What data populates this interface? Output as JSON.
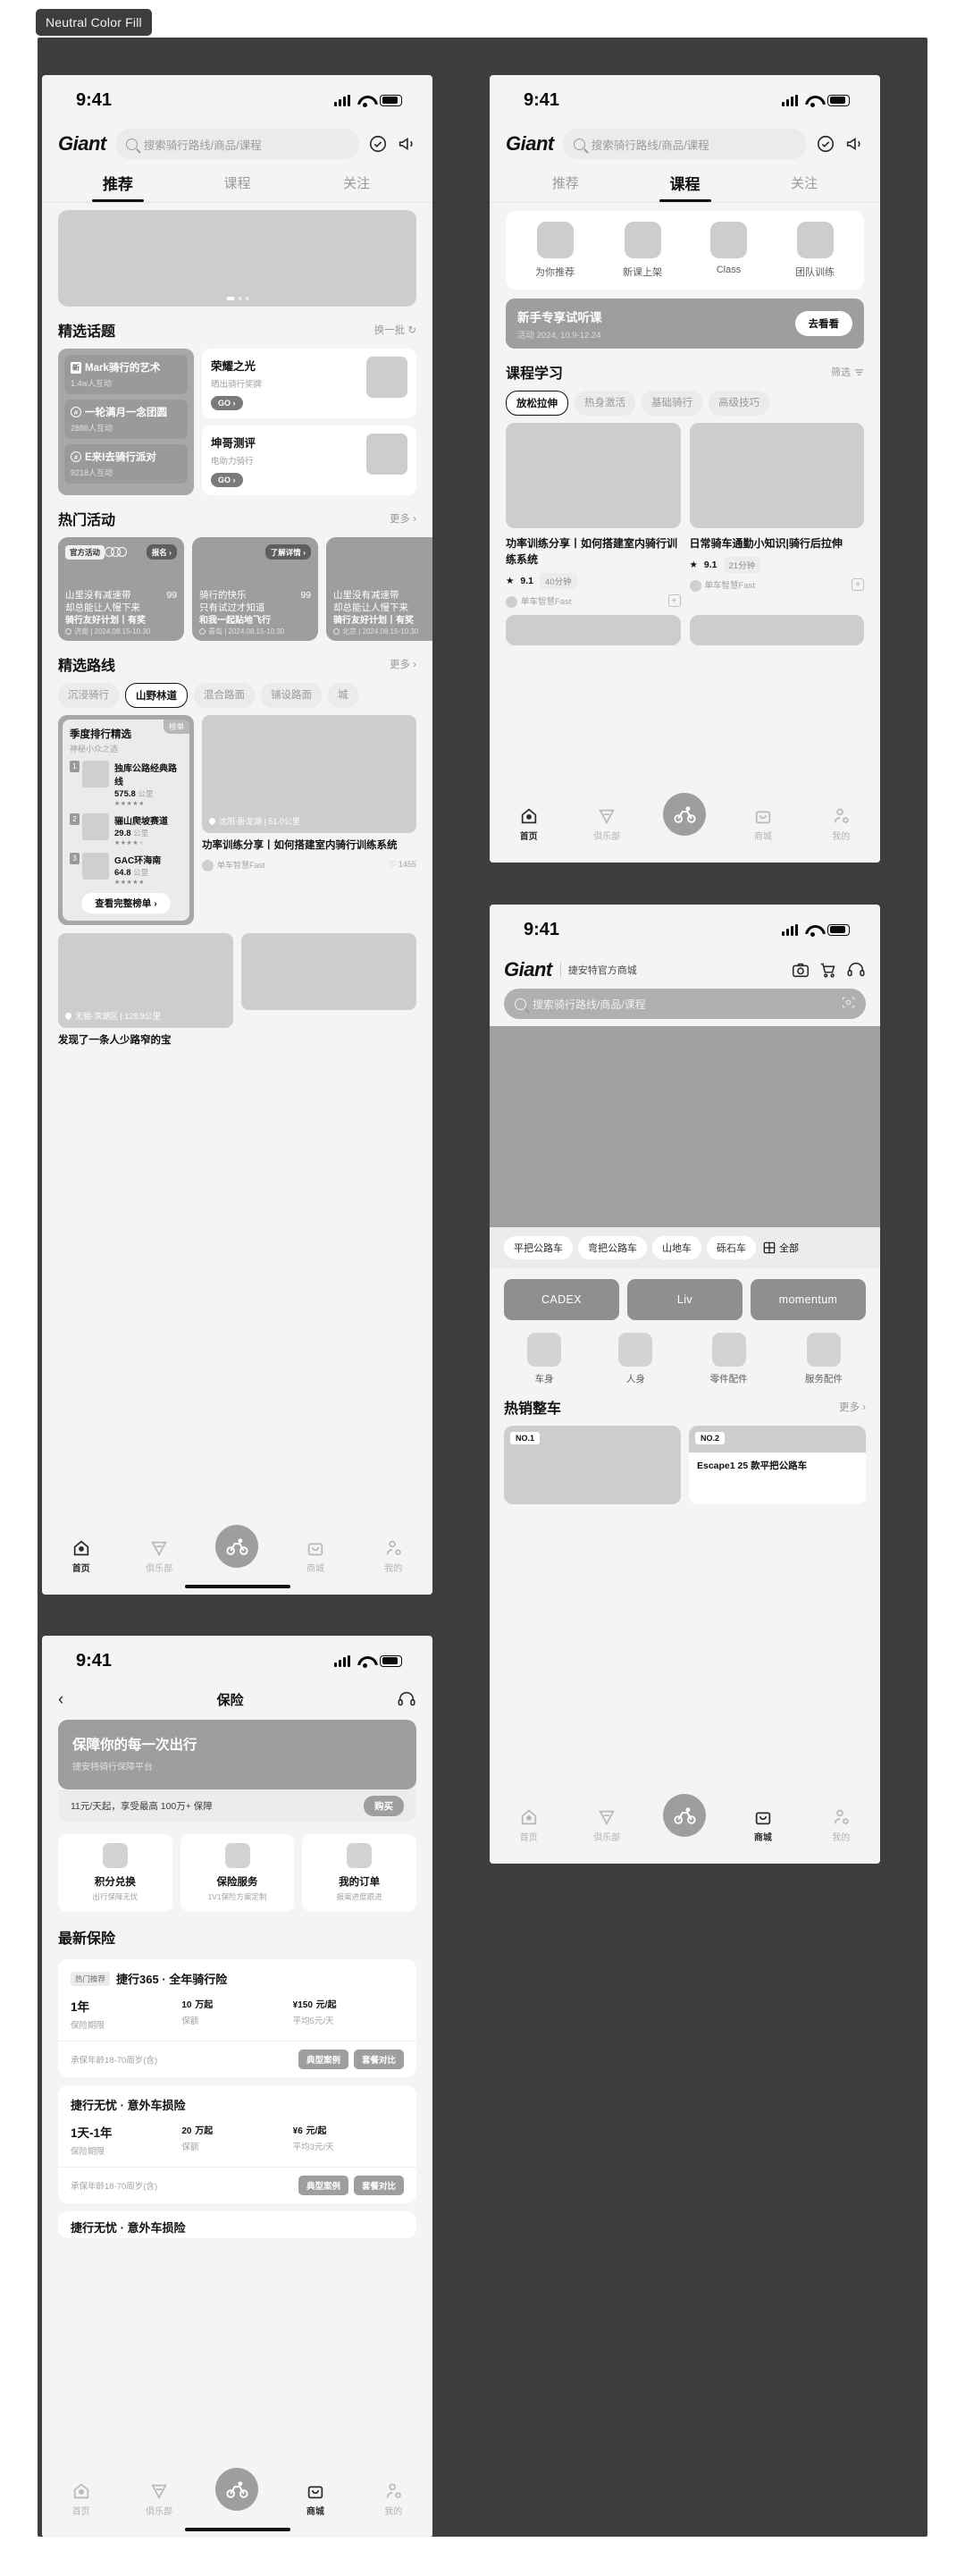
{
  "page": {
    "tag_label": "Neutral Color Fill"
  },
  "status": {
    "time": "9:41"
  },
  "app": {
    "brand": "Giant",
    "search_placeholder": "搜索骑行路线/商品/课程",
    "icons": {
      "check": "check-circle-icon",
      "bell": "megaphone-icon"
    }
  },
  "tabbar": {
    "items": [
      {
        "label": "首页",
        "icon": "home-icon"
      },
      {
        "label": "俱乐部",
        "icon": "club-icon"
      },
      {
        "label": "",
        "icon": "bike-icon"
      },
      {
        "label": "商城",
        "icon": "shop-icon"
      },
      {
        "label": "我的",
        "icon": "profile-icon"
      }
    ]
  },
  "phone1": {
    "tabs": [
      {
        "label": "推荐",
        "active": true
      },
      {
        "label": "课程",
        "active": false
      },
      {
        "label": "关注",
        "active": false
      }
    ],
    "topics": {
      "title": "精选话题",
      "more": "换一批 ↻",
      "list": [
        {
          "badge": "新",
          "title": "Mark骑行的艺术",
          "sub": "1.4w人互动"
        },
        {
          "badge": "#",
          "title": "一轮满月一念团圆",
          "sub": "2888人互动"
        },
        {
          "badge": "#",
          "title": "E来I去骑行派对",
          "sub": "9218人互动"
        }
      ],
      "cards": [
        {
          "title": "荣耀之光",
          "sub": "晒出骑行奖牌",
          "cta": "GO ›"
        },
        {
          "title": "坤哥测评",
          "sub": "电助力骑行",
          "cta": "GO ›"
        }
      ]
    },
    "activities": {
      "title": "热门活动",
      "more": "更多 ›",
      "list": [
        {
          "chip": "官方活动",
          "cta": "报名 ›",
          "line1": "山里没有减速带",
          "line2": "却总能让人慢下来",
          "count": "99",
          "sub": "骑行友好计划丨有奖",
          "meta": "济南 | 2024.08.15-10.30"
        },
        {
          "chip": "",
          "cta": "了解详情 ›",
          "line1": "骑行的快乐",
          "line2": "只有试过才知道",
          "count": "99",
          "sub": "和我一起贴地飞行",
          "meta": "青岛 | 2024.08.15-10.30"
        },
        {
          "chip": "",
          "cta": "",
          "line1": "山里没有减速带",
          "line2": "却总能让人慢下来",
          "count": "",
          "sub": "骑行友好计划丨有奖",
          "meta": "北京 | 2024.08.15-10.30"
        }
      ]
    },
    "routes": {
      "title": "精选路线",
      "more": "更多 ›",
      "chips": [
        {
          "label": "沉浸骑行",
          "active": false
        },
        {
          "label": "山野林道",
          "active": true
        },
        {
          "label": "混合路面",
          "active": false
        },
        {
          "label": "铺设路面",
          "active": false
        },
        {
          "label": "城",
          "active": false
        }
      ],
      "rank": {
        "tab": "榜单",
        "title": "季度排行精选",
        "sub": "神秘小众之选",
        "items": [
          {
            "no": "1",
            "name": "独库公路经典路线",
            "km": "575.8",
            "unit": "公里",
            "stars": 5
          },
          {
            "no": "2",
            "name": "骊山爬坡赛道",
            "km": "29.8",
            "unit": "公里",
            "stars": 4
          },
          {
            "no": "3",
            "name": "GAC环海南",
            "km": "64.8",
            "unit": "公里",
            "stars": 5
          }
        ],
        "button": "查看完整榜单 ›"
      },
      "feed": [
        {
          "meta": "沈阳·卧龙湖 | 51.0公里",
          "title": "功率训练分享丨如何搭建室内骑行训练系统",
          "author": "单车智慧Fast",
          "likes": "♡ 1455"
        },
        {
          "meta": "无锡·滨湖区 | 128.9公里",
          "title": "发现了一条人少路窄的宝",
          "author": "",
          "likes": ""
        }
      ]
    }
  },
  "phone2": {
    "tabs": [
      {
        "label": "推荐",
        "active": false
      },
      {
        "label": "课程",
        "active": true
      },
      {
        "label": "关注",
        "active": false
      }
    ],
    "quick": [
      {
        "label": "为你推荐"
      },
      {
        "label": "新课上架"
      },
      {
        "label": "Class"
      },
      {
        "label": "团队训练"
      }
    ],
    "promo": {
      "title": "新手专享试听课",
      "sub": "活动 2024, 10.9-12.24",
      "cta": "去看看"
    },
    "section": {
      "title": "课程学习",
      "filter": "筛选"
    },
    "chips": [
      {
        "label": "放松拉伸",
        "active": true
      },
      {
        "label": "热身激活",
        "active": false
      },
      {
        "label": "基础骑行",
        "active": false
      },
      {
        "label": "高级技巧",
        "active": false
      }
    ],
    "courses": [
      {
        "title": "功率训练分享丨如何搭建室内骑行训练系统",
        "rating": "9.1",
        "duration": "40分钟",
        "author": "单车智慧Fast"
      },
      {
        "title": "日常骑车通勤小知识|骑行后拉伸",
        "rating": "9.1",
        "duration": "21分钟",
        "author": "单车智慧Fast"
      }
    ]
  },
  "phone3": {
    "brand": "Giant",
    "sub_brand": "捷安特官方商城",
    "search_placeholder": "搜索骑行路线/商品/课程",
    "header_icons": [
      "camera-icon",
      "cart-icon",
      "headset-icon"
    ],
    "chips": [
      {
        "label": "平把公路车"
      },
      {
        "label": "弯把公路车"
      },
      {
        "label": "山地车"
      },
      {
        "label": "砾石车"
      }
    ],
    "all_label": "全部",
    "brands": [
      {
        "label": "CADEX"
      },
      {
        "label": "Liv"
      },
      {
        "label": "momentum"
      }
    ],
    "cats": [
      {
        "label": "车身"
      },
      {
        "label": "人身"
      },
      {
        "label": "零件配件"
      },
      {
        "label": "服务配件"
      }
    ],
    "hot": {
      "title": "热销整车",
      "more": "更多 ›",
      "items": [
        {
          "tag": "NO.1",
          "name": ""
        },
        {
          "tag": "NO.2",
          "name": "Escape1 25 款平把公路车"
        }
      ]
    }
  },
  "phone4": {
    "nav_title": "保险",
    "banner": {
      "title": "保障你的每一次出行",
      "sub": "捷安特骑行保障平台"
    },
    "bar": {
      "text": "11元/天起，享受最高 100万+ 保障",
      "cta": "购买"
    },
    "entries": [
      {
        "title": "积分兑换",
        "sub": "出行保障无忧"
      },
      {
        "title": "保险服务",
        "sub": "1V1保险方案定制"
      },
      {
        "title": "我的订单",
        "sub": "报案进度跟进"
      }
    ],
    "section_title": "最新保险",
    "products": [
      {
        "badge": "热门推荐",
        "name": "捷行365 · 全年骑行险",
        "cols": [
          {
            "value": "1年",
            "unit": "",
            "label": "保险期限"
          },
          {
            "value": "10",
            "unit": "万起",
            "label": "保额"
          },
          {
            "value": "¥150",
            "unit": "元/起",
            "label": "平均5元/天"
          }
        ],
        "age": "承保年龄18-70周岁(含)",
        "buttons": [
          "典型案例",
          "套餐对比"
        ]
      },
      {
        "badge": "",
        "name": "捷行无忧 · 意外车损险",
        "cols": [
          {
            "value": "1天-1年",
            "unit": "",
            "label": "保险期限"
          },
          {
            "value": "20",
            "unit": "万起",
            "label": "保额"
          },
          {
            "value": "¥6",
            "unit": "元/起",
            "label": "平均3元/天"
          }
        ],
        "age": "承保年龄18-70周岁(含)",
        "buttons": [
          "典型案例",
          "套餐对比"
        ]
      },
      {
        "badge": "",
        "name": "捷行无忧 · 意外车损险",
        "cols": [],
        "age": "",
        "buttons": []
      }
    ]
  }
}
